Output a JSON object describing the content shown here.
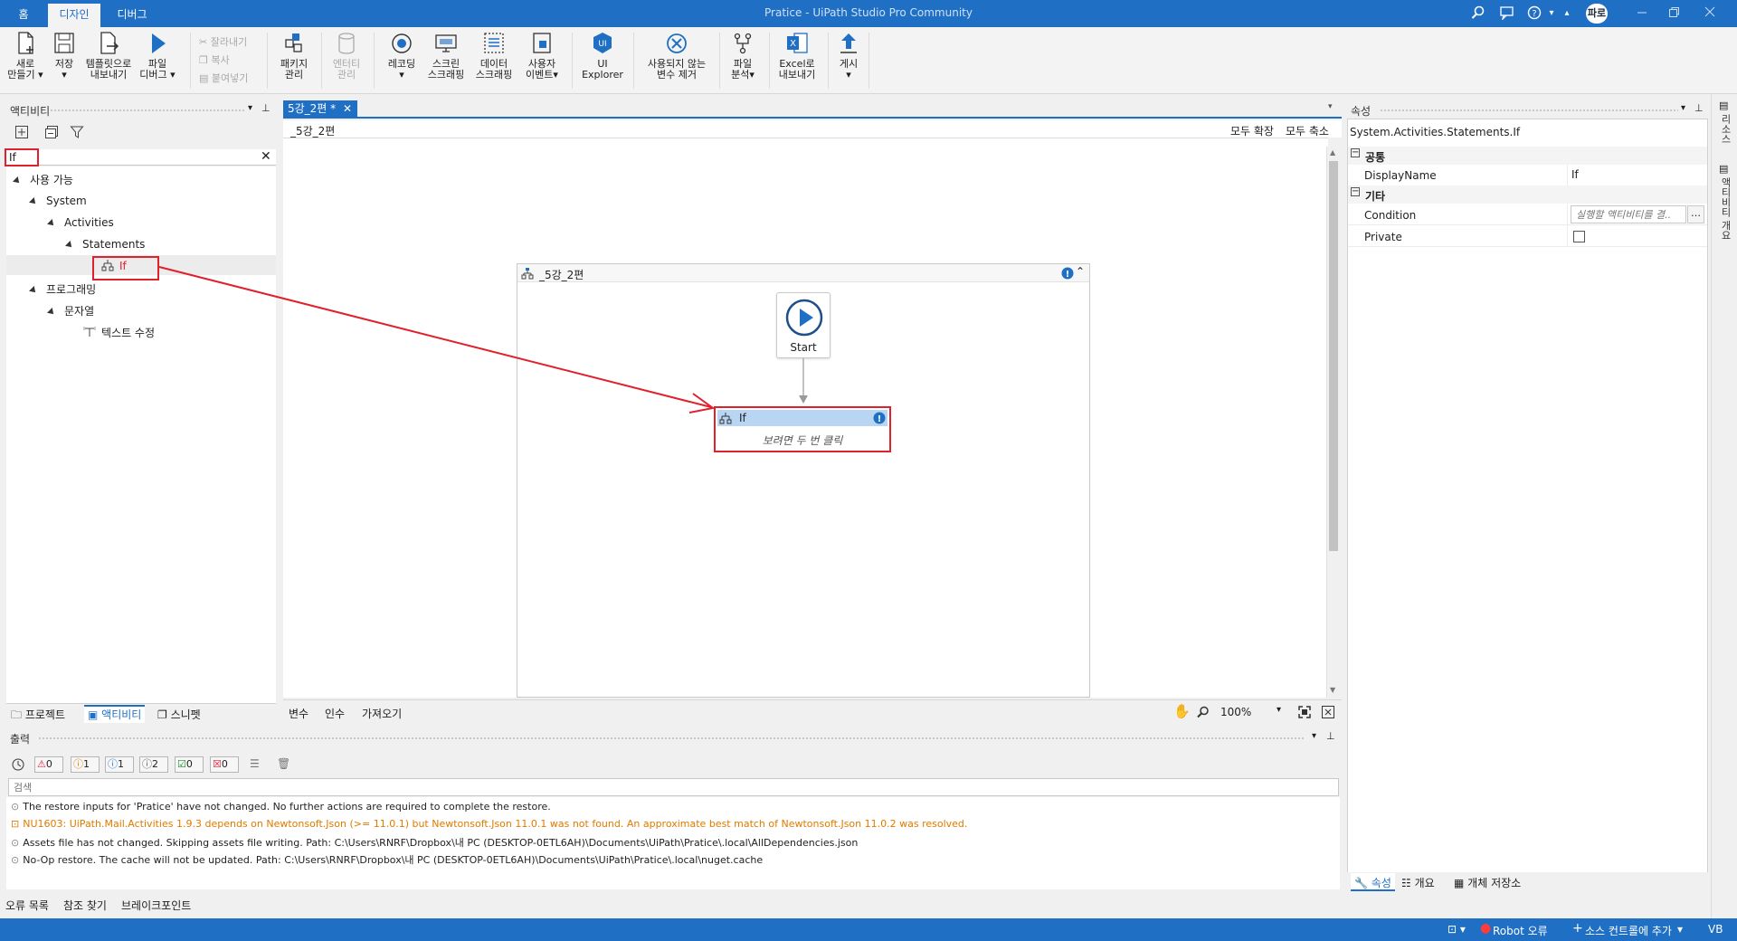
{
  "titlebar": {
    "home_tab": "홈",
    "design_tab": "디자인",
    "debug_tab": "디버그",
    "app_title": "Pratice - UiPath Studio Pro Community",
    "avatar_initials": "파로"
  },
  "ribbon": {
    "new": "새로\n만들기",
    "save": "저장",
    "export_template": "템플릿으로\n내보내기",
    "debug_file": "파일\n디버그",
    "cut": "잘라내기",
    "copy": "복사",
    "paste": "붙여넣기",
    "manage_packages": "패키지\n관리",
    "manage_entities": "엔터티\n관리",
    "recording": "레코딩",
    "screen_scraping": "스크린\n스크래핑",
    "data_scraping": "데이터\n스크래핑",
    "user_events": "사용자\n이벤트",
    "ui_explorer": "UI\nExplorer",
    "remove_unused_variables": "사용되지 않는\n변수 제거",
    "file_analysis": "파일\n분석",
    "export_excel": "Excel로\n내보내기",
    "publish": "게시"
  },
  "activities_panel": {
    "title": "액티비티",
    "search_value": "If",
    "tree": {
      "available": "사용 가능",
      "system": "System",
      "activities": "Activities",
      "statements": "Statements",
      "if_item": "If",
      "programming": "프로그래밍",
      "string": "문자열",
      "modify_text": "텍스트 수정"
    },
    "bottom_tabs": [
      "프로젝트",
      "액티비티",
      "스니펫"
    ]
  },
  "designer": {
    "doc_tab": "5강_2편 *",
    "breadcrumb": "_5강_2편",
    "expand_all": "모두 확장",
    "collapse_all": "모두 축소",
    "sequence_title": "_5강_2편",
    "start_label": "Start",
    "if_title": "If",
    "if_hint": "보려면 두 번 클릭",
    "bottom_tabs": [
      "변수",
      "인수",
      "가져오기"
    ],
    "zoom": "100%"
  },
  "output_panel": {
    "title": "출력",
    "filters": [
      {
        "icon": "error-icon",
        "count": "0"
      },
      {
        "icon": "warning-icon",
        "count": "1"
      },
      {
        "icon": "info-icon",
        "count": "1"
      },
      {
        "icon": "trace-icon",
        "count": "2"
      },
      {
        "icon": "success-icon",
        "count": "0"
      },
      {
        "icon": "failure-icon",
        "count": "0"
      }
    ],
    "search_placeholder": "검색",
    "lines": [
      {
        "text": "The restore inputs for 'Pratice' have not changed. No further actions are required to complete the restore.",
        "level": "info"
      },
      {
        "text": "NU1603: UiPath.Mail.Activities 1.9.3 depends on Newtonsoft.Json (>= 11.0.1) but Newtonsoft.Json 11.0.1 was not found. An approximate best match of Newtonsoft.Json 11.0.2 was resolved.",
        "level": "warning"
      },
      {
        "text": "Assets file has not changed. Skipping assets file writing. Path: C:\\Users\\RNRF\\Dropbox\\내 PC (DESKTOP-0ETL6AH)\\Documents\\UiPath\\Pratice\\.local\\AllDependencies.json",
        "level": "info"
      },
      {
        "text": "No-Op restore. The cache will not be updated. Path: C:\\Users\\RNRF\\Dropbox\\내 PC (DESKTOP-0ETL6AH)\\Documents\\UiPath\\Pratice\\.local\\nuget.cache",
        "level": "info"
      }
    ],
    "bottom_tabs": [
      "오류 목록",
      "참조 찾기",
      "브레이크포인트"
    ]
  },
  "properties_panel": {
    "title": "속성",
    "type_name": "System.Activities.Statements.If",
    "cat_common": "공통",
    "display_name_label": "DisplayName",
    "display_name_value": "If",
    "cat_misc": "기타",
    "condition_label": "Condition",
    "condition_placeholder": "실행할 액티비티를 결..",
    "private_label": "Private",
    "bottom_tabs": [
      "속성",
      "개요",
      "개체 저장소"
    ]
  },
  "right_sidebar": {
    "tabs": [
      "리소스",
      "액티비티 개요"
    ]
  },
  "statusbar": {
    "robot_error": "Robot 오류",
    "add_source_control": "소스 컨트롤에 추가",
    "vb": "VB"
  },
  "colors": {
    "accent": "#1f6fc5",
    "annotation_red": "#e0202a",
    "warning_orange": "#e07a00"
  }
}
